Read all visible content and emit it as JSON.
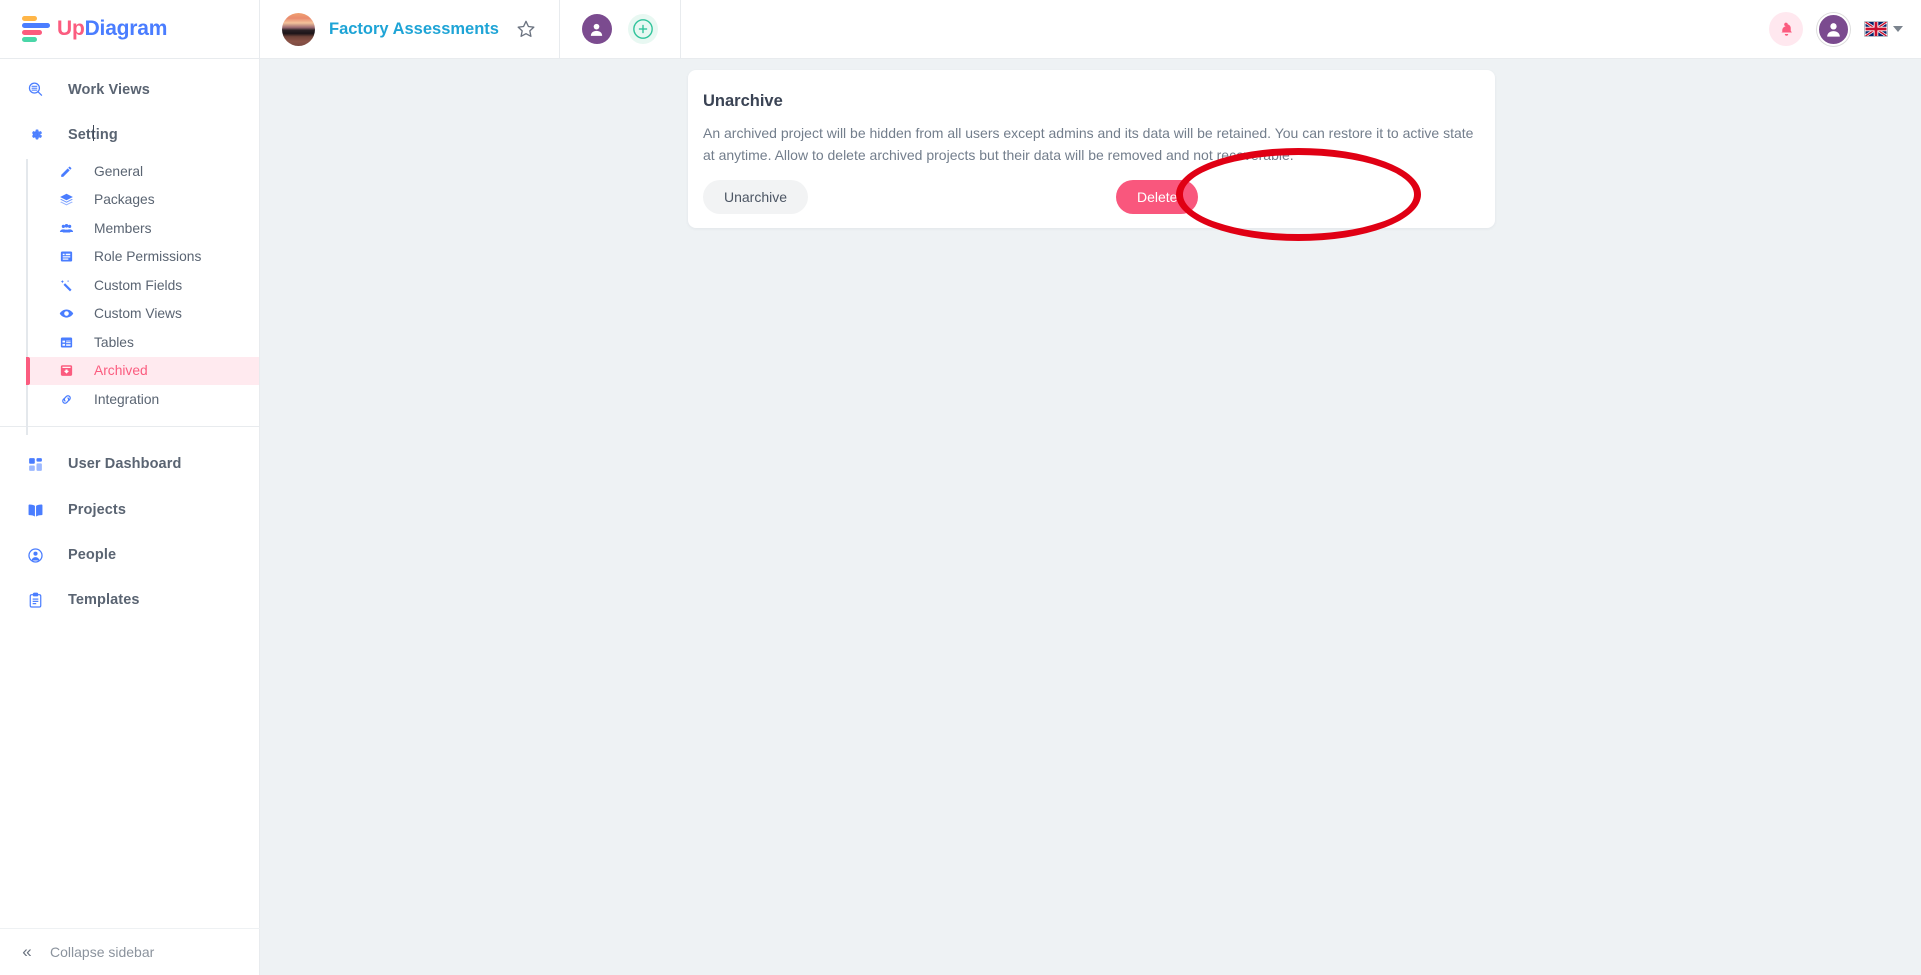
{
  "app": {
    "logo_up": "Up",
    "logo_diagram": "Diagram"
  },
  "header": {
    "project_title": "Factory Assessments",
    "star_icon": "star-icon",
    "member_avatar_icon": "user-avatar-icon",
    "add_member_icon": "plus-circle-icon",
    "bell_icon": "bell-icon",
    "account_avatar_icon": "user-avatar-icon",
    "language": "en",
    "language_flag": "uk-flag-icon"
  },
  "sidebar": {
    "top_items": [
      {
        "label": "Work Views",
        "icon": "search-views-icon"
      },
      {
        "label": "Setting",
        "icon": "gear-icon"
      }
    ],
    "setting_children": [
      {
        "label": "General",
        "icon": "pencil-icon",
        "active": false
      },
      {
        "label": "Packages",
        "icon": "layers-icon",
        "active": false
      },
      {
        "label": "Members",
        "icon": "people-icon",
        "active": false
      },
      {
        "label": "Role Permissions",
        "icon": "list-card-icon",
        "active": false
      },
      {
        "label": "Custom Fields",
        "icon": "magic-wand-icon",
        "active": false
      },
      {
        "label": "Custom Views",
        "icon": "eye-icon",
        "active": false
      },
      {
        "label": "Tables",
        "icon": "table-icon",
        "active": false
      },
      {
        "label": "Archived",
        "icon": "archive-box-icon",
        "active": true
      },
      {
        "label": "Integration",
        "icon": "link-icon",
        "active": false
      }
    ],
    "bottom_items": [
      {
        "label": "User Dashboard",
        "icon": "dashboard-grid-icon"
      },
      {
        "label": "Projects",
        "icon": "book-icon"
      },
      {
        "label": "People",
        "icon": "person-circle-icon"
      },
      {
        "label": "Templates",
        "icon": "clipboard-icon"
      }
    ],
    "collapse": {
      "label": "Collapse sidebar",
      "icon": "double-chevron-left-icon"
    }
  },
  "main": {
    "card": {
      "title": "Unarchive",
      "description": "An archived project will be hidden from all users except admins and its data will be retained. You can restore it to active state at anytime. Allow to delete archived projects but their data will be removed and not recoverable.",
      "unarchive_label": "Unarchive",
      "delete_label": "Delete"
    }
  },
  "colors": {
    "accent_pink": "#fb5c7f",
    "accent_blue": "#4a7dff",
    "project_title": "#1ea4d6",
    "delete_button": "#f9577d",
    "annotation": "#e00014",
    "page_background": "#eef2f4"
  }
}
